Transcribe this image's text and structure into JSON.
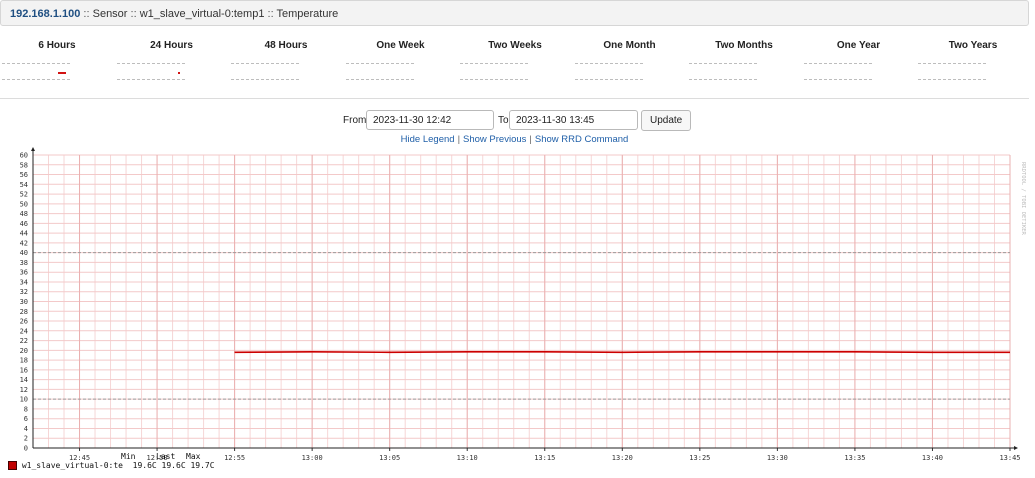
{
  "breadcrumb": {
    "host": "192.168.1.100",
    "sep": "::",
    "sensor": "Sensor",
    "device": "w1_slave_virtual-0:temp1",
    "metric": "Temperature"
  },
  "periods": [
    {
      "label": "6 Hours",
      "mark": true
    },
    {
      "label": "24 Hours",
      "mark": true
    },
    {
      "label": "48 Hours",
      "mark": false
    },
    {
      "label": "One Week",
      "mark": false
    },
    {
      "label": "Two Weeks",
      "mark": false
    },
    {
      "label": "One Month",
      "mark": false
    },
    {
      "label": "Two Months",
      "mark": false
    },
    {
      "label": "One Year",
      "mark": false
    },
    {
      "label": "Two Years",
      "mark": false
    }
  ],
  "form": {
    "from_label": "From",
    "from_value": "2023-11-30 12:42",
    "to_label": "To",
    "to_value": "2023-11-30 13:45",
    "update_label": "Update"
  },
  "links": {
    "hide_legend": "Hide Legend",
    "show_previous": "Show Previous",
    "show_rrd": "Show RRD Command",
    "sep": "|"
  },
  "chart_data": {
    "type": "line",
    "watermark": "RRDTOOL / TOBI OETIKER",
    "x_ticks": [
      "12:45",
      "12:50",
      "12:55",
      "13:00",
      "13:05",
      "13:10",
      "13:15",
      "13:20",
      "13:25",
      "13:30",
      "13:35",
      "13:40",
      "13:45"
    ],
    "x_range_minutes": [
      0,
      63
    ],
    "x_tick_minutes": [
      3,
      8,
      13,
      18,
      23,
      28,
      33,
      38,
      43,
      48,
      53,
      58,
      63
    ],
    "ylim": [
      0,
      60
    ],
    "y_tick_step": 2,
    "thresholds": [
      40,
      10
    ],
    "grid": true,
    "series": [
      {
        "name": "w1_slave_virtual-0:te",
        "color": "#cc0000",
        "x_minutes": [
          13,
          18,
          23,
          28,
          33,
          38,
          43,
          48,
          53,
          58,
          63
        ],
        "values": [
          19.6,
          19.7,
          19.6,
          19.7,
          19.7,
          19.6,
          19.7,
          19.7,
          19.7,
          19.6,
          19.6
        ]
      }
    ],
    "legend": {
      "headers": [
        "Min",
        "Last",
        "Max"
      ],
      "min": "19.6C",
      "last": "19.6C",
      "max": "19.7C"
    }
  }
}
